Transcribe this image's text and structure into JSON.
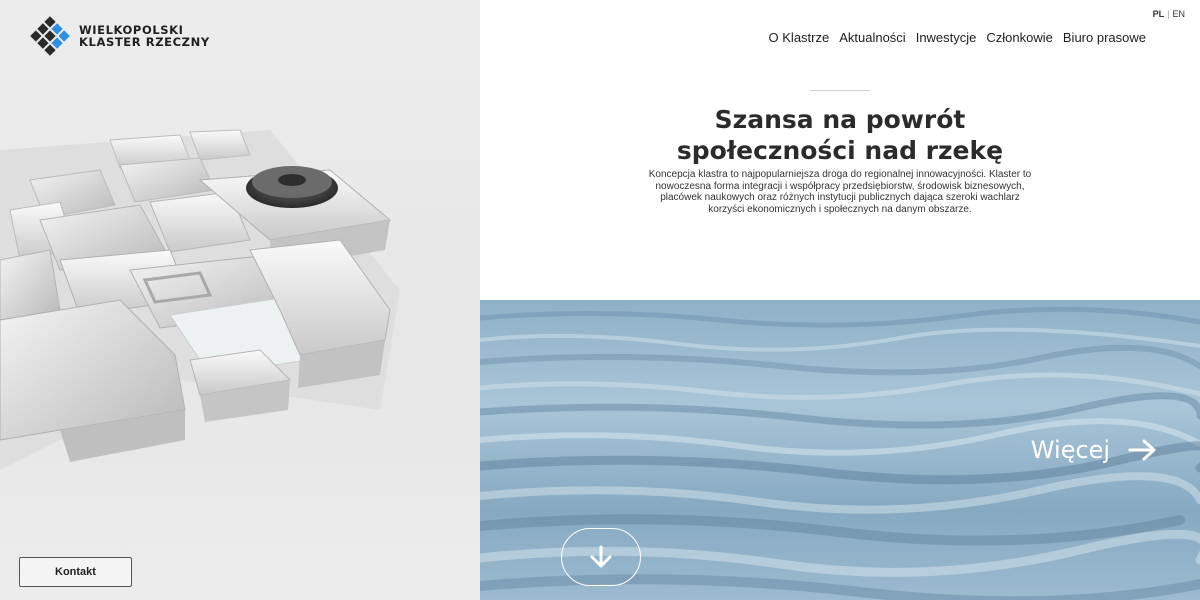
{
  "brand": {
    "line1": "WIELKOPOLSKI",
    "line2": "KLASTER RZECZNY",
    "colors": {
      "blue": "#2f8fe0",
      "dark": "#2a2a2a"
    }
  },
  "language": {
    "options": [
      "PL",
      "EN"
    ],
    "separator": "|",
    "active": "PL"
  },
  "nav": {
    "items": [
      {
        "label": "O Klastrze"
      },
      {
        "label": "Aktualności"
      },
      {
        "label": "Inwestycje"
      },
      {
        "label": "Członkowie"
      },
      {
        "label": "Biuro prasowe"
      }
    ]
  },
  "hero": {
    "title_line1": "Szansa na powrót",
    "title_line2": "społeczności nad rzekę",
    "description": "Koncepcja klastra to najpopularniejsza droga do regionalnej innowacyjności. Klaster to nowoczesna forma integracji i współpracy przedsiębiorstw, środowisk biznesowych, placówek naukowych oraz różnych instytucji publicznych dająca szeroki wachlarz korzyści ekonomicznych i społecznych na danym obszarze."
  },
  "actions": {
    "more_label": "Więcej",
    "more_icon": "arrow-right-icon",
    "scroll_icon": "arrow-down-icon",
    "contact_label": "Kontakt"
  }
}
